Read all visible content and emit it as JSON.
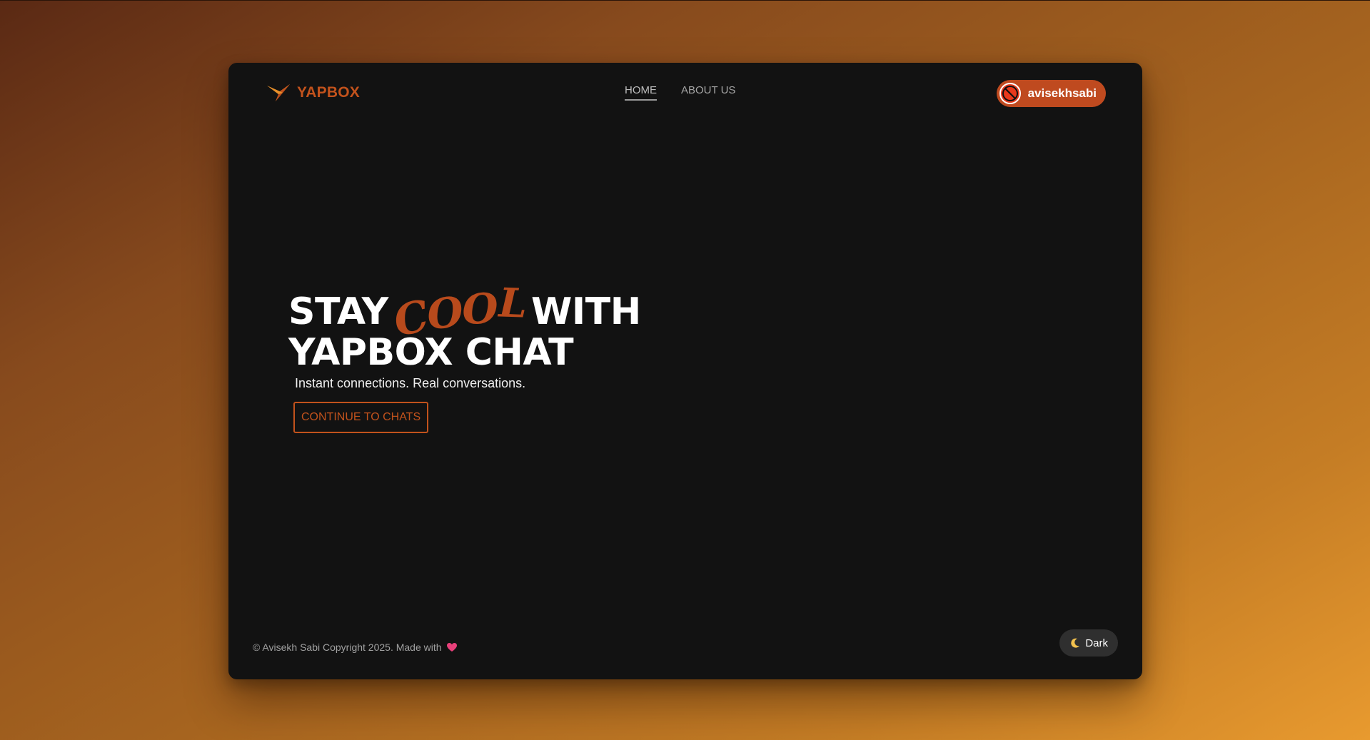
{
  "brand": {
    "name": "YAPBOX",
    "icon": "swallow-bird-icon",
    "color": "#c2521c"
  },
  "nav": {
    "items": [
      {
        "label": "HOME",
        "active": true
      },
      {
        "label": "ABOUT US",
        "active": false
      }
    ]
  },
  "user": {
    "name": "avisekhsabi",
    "avatar_icon": "no-entry-icon",
    "pill_color": "#bf4a1f"
  },
  "hero": {
    "line1_start": "STAY",
    "highlight": [
      "C",
      "O",
      "O",
      "L"
    ],
    "line1_end": "WITH",
    "line2": "YAPBOX CHAT",
    "subtitle": "Instant connections. Real conversations.",
    "cta_label": "CONTINUE TO CHATS"
  },
  "footer": {
    "copyright": "© Avisekh Sabi Copyright 2025. Made with",
    "heart_icon": "heart-icon",
    "theme_toggle": {
      "label": "Dark",
      "icon": "moon-icon"
    }
  },
  "colors": {
    "accent": "#c2521c",
    "card_background": "#121212",
    "heart": "#e8407a"
  }
}
